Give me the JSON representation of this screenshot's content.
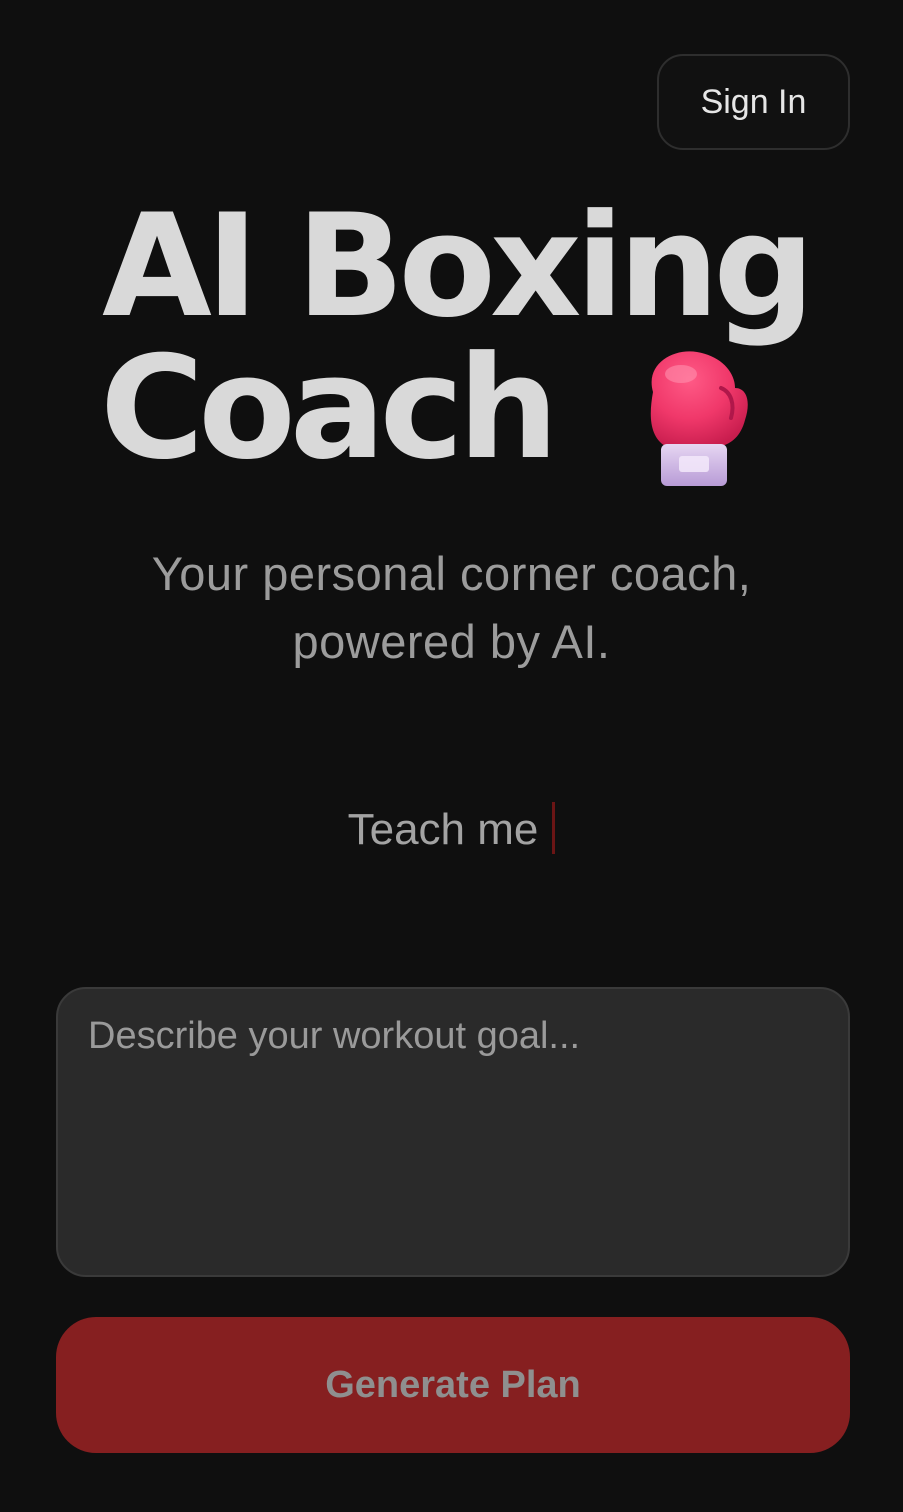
{
  "header": {
    "signin_label": "Sign In"
  },
  "hero": {
    "title_line1": "AI Boxing",
    "title_line2": "Coach",
    "emoji_icon": "boxing-glove-icon",
    "subtitle_line1": "Your personal corner coach,",
    "subtitle_line2": "powered by AI."
  },
  "typing": {
    "text": "Teach me"
  },
  "form": {
    "goal_placeholder": "Describe your workout goal...",
    "goal_value": "",
    "generate_label": "Generate Plan"
  },
  "colors": {
    "background": "#0f0f0f",
    "accent": "#861f20",
    "title": "#d9d9d9",
    "muted_text": "#9c9c9c",
    "input_bg": "#2a2a2a"
  }
}
